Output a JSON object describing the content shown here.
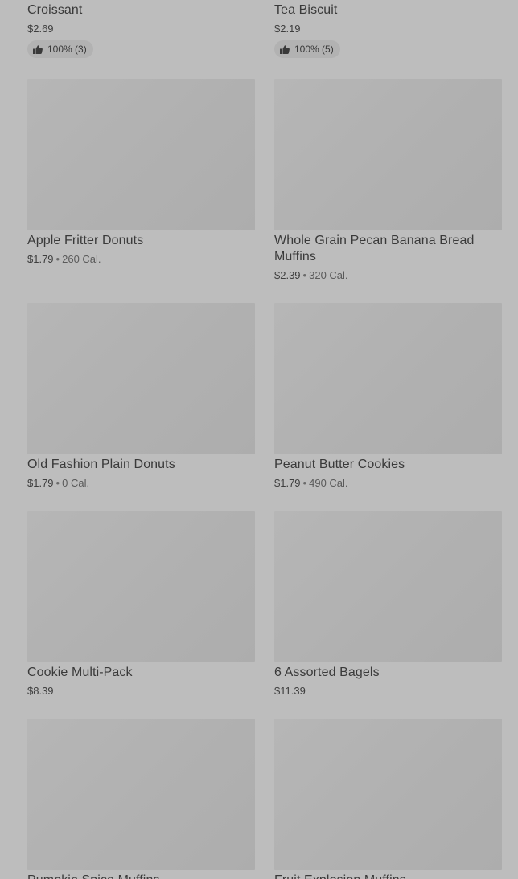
{
  "items": [
    {
      "name": "Croissant",
      "price": "$2.69",
      "rating": "100% (3)"
    },
    {
      "name": "Tea Biscuit",
      "price": "$2.19",
      "rating": "100% (5)"
    },
    {
      "name": "Apple Fritter Donuts",
      "price": "$1.79",
      "separator": "•",
      "calories": "260 Cal."
    },
    {
      "name": "Whole Grain Pecan Banana Bread Muffins",
      "price": "$2.39",
      "separator": "•",
      "calories": "320 Cal."
    },
    {
      "name": "Old Fashion Plain Donuts",
      "price": "$1.79",
      "separator": "•",
      "calories": "0 Cal."
    },
    {
      "name": "Peanut Butter Cookies",
      "price": "$1.79",
      "separator": "•",
      "calories": "490 Cal."
    },
    {
      "name": "Cookie Multi-Pack",
      "price": "$8.39"
    },
    {
      "name": "6 Assorted Bagels",
      "price": "$11.39"
    },
    {
      "name": "Pumpkin Spice Muffins"
    },
    {
      "name": "Fruit Explosion Muffins"
    }
  ]
}
